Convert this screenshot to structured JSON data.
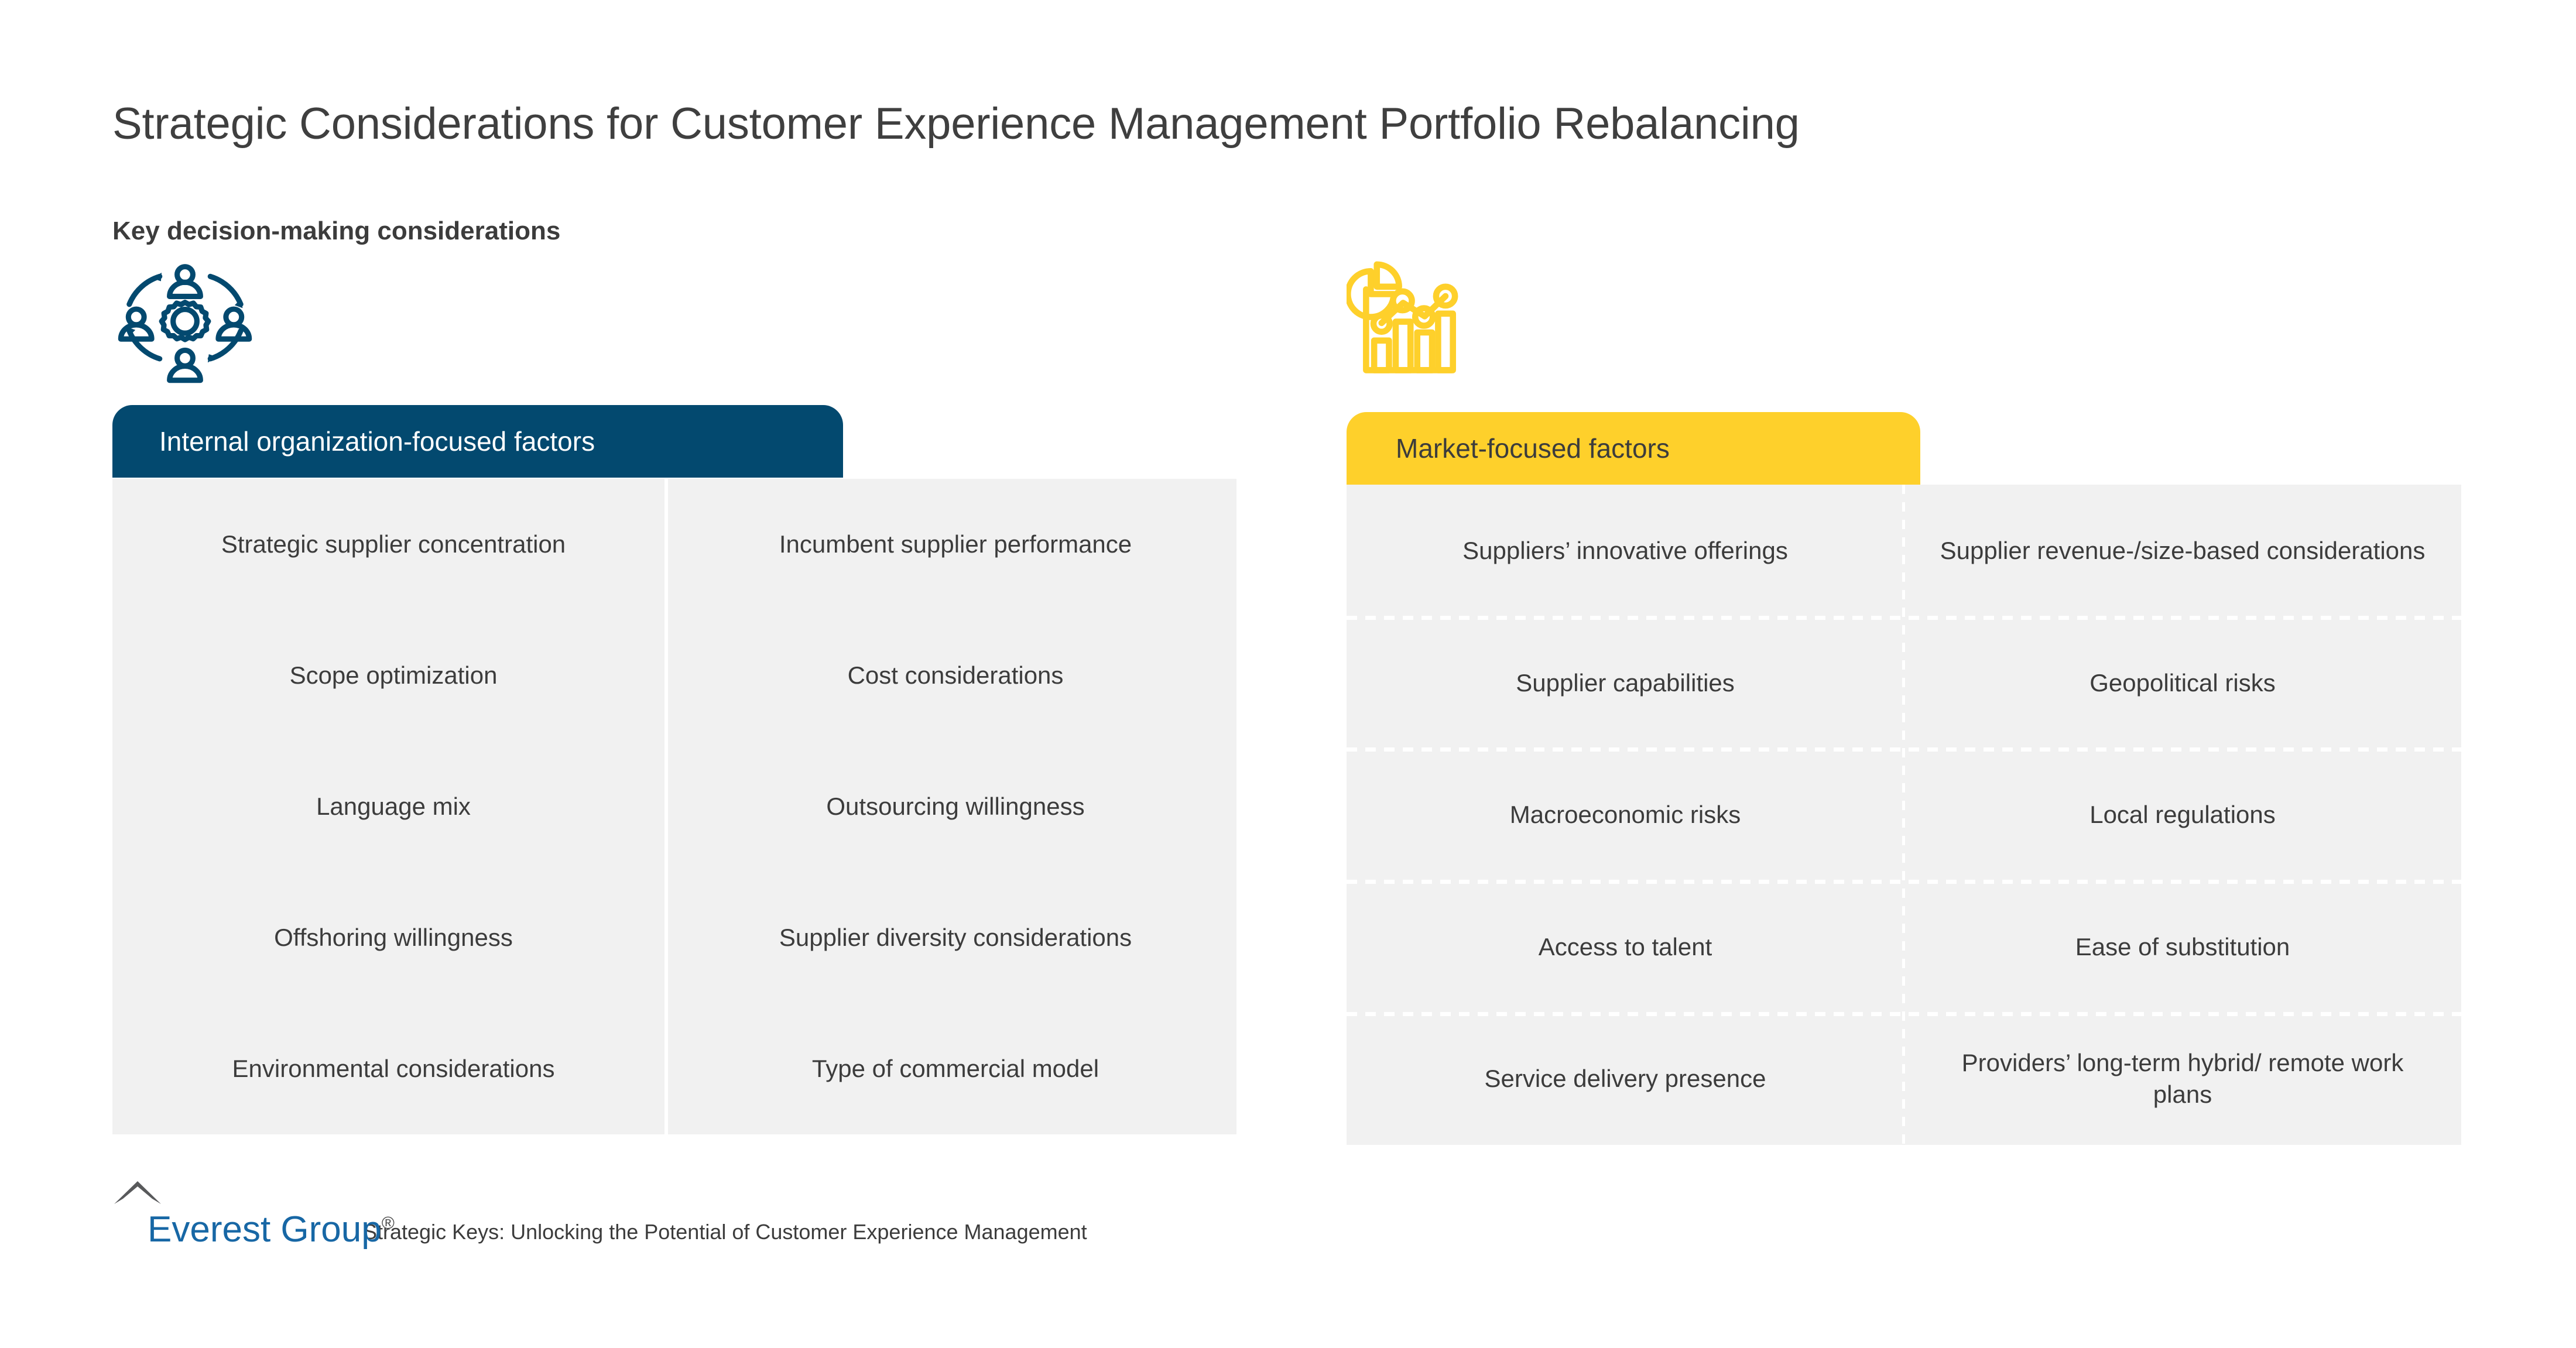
{
  "page": {
    "title": "Strategic Considerations for Customer Experience Management Portfolio Rebalancing",
    "subtitle": "Key decision-making considerations"
  },
  "colors": {
    "navy": "#03496f",
    "yellow": "#fed02b",
    "cell_bg": "#f1f1f1",
    "text": "#3c3c3c",
    "logo_blue": "#1767a5",
    "logo_gray": "#58595b"
  },
  "panels": {
    "internal": {
      "icon": "people-gear-cycle-icon",
      "header_label": "Internal organization-focused factors",
      "columns": 2,
      "cells": [
        "Strategic supplier concentration",
        "Incumbent supplier performance",
        "Scope optimization",
        "Cost considerations",
        "Language mix",
        "Outsourcing willingness",
        "Offshoring willingness",
        "Supplier diversity considerations",
        "Environmental considerations",
        "Type of commercial model"
      ]
    },
    "market": {
      "icon": "bar-pie-chart-icon",
      "header_label": "Market-focused factors",
      "columns": 2,
      "cells": [
        "Suppliers’ innovative offerings",
        "Supplier revenue-/size-based considerations",
        "Supplier capabilities",
        "Geopolitical risks",
        "Macroeconomic risks",
        "Local regulations",
        "Access to talent",
        "Ease of substitution",
        "Service delivery presence",
        "Providers’ long-term hybrid/ remote work plans"
      ]
    }
  },
  "footer": {
    "logo_icon": "everest-peak-logo-icon",
    "logo_text": "Everest Group",
    "logo_registered": "®",
    "caption": "Strategic Keys: Unlocking the Potential of Customer Experience Management"
  }
}
